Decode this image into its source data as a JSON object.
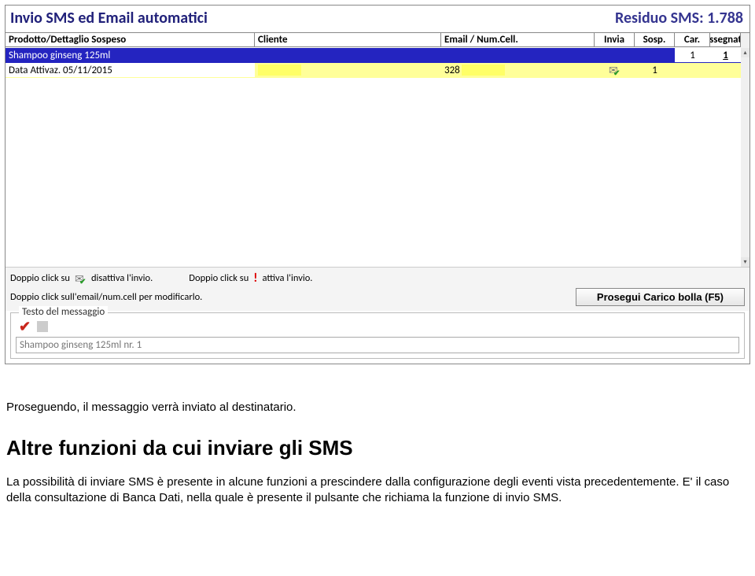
{
  "header": {
    "title_left": "Invio SMS ed Email automatici",
    "title_right": "Residuo SMS: 1.788"
  },
  "grid": {
    "columns": {
      "prod": "Prodotto/Dettaglio Sospeso",
      "cli": "Cliente",
      "email": "Email / Num.Cell.",
      "invia": "Invia",
      "sosp": "Sosp.",
      "car": "Car.",
      "ass": "Assegnato"
    },
    "rows": [
      {
        "prod": "Shampoo ginseng 125ml",
        "cli": "",
        "email": "",
        "invia": "",
        "sosp": "",
        "car": "1",
        "ass": "1",
        "selected": true,
        "ass_underline": true
      },
      {
        "prod": "Data Attivaz. 05/11/2015",
        "cli_redacted": true,
        "email_prefix": "328",
        "email_redacted": true,
        "invia_icon": true,
        "sosp": "1",
        "car": "",
        "ass": "",
        "selected": false
      }
    ]
  },
  "hints": {
    "dbl1": "Doppio click su",
    "disattiva": "disattiva l'invio.",
    "dbl2": "Doppio click su",
    "attiva": "attiva l'invio.",
    "line2": "Doppio click sull'email/num.cell per modificarlo.",
    "button": "Prosegui Carico bolla (F5)"
  },
  "msgbox": {
    "legend": "Testo del messaggio",
    "value": "Shampoo ginseng 125ml nr. 1"
  },
  "doc": {
    "p1": "Proseguendo, il messaggio verrà inviato al destinatario.",
    "h2": "Altre funzioni da cui inviare gli SMS",
    "p2": "La possibilità di inviare SMS è presente in alcune funzioni a prescindere dalla configurazione degli eventi vista precedentemente. E' il caso della consultazione di Banca Dati, nella quale è presente il pulsante che richiama la funzione di invio SMS."
  }
}
